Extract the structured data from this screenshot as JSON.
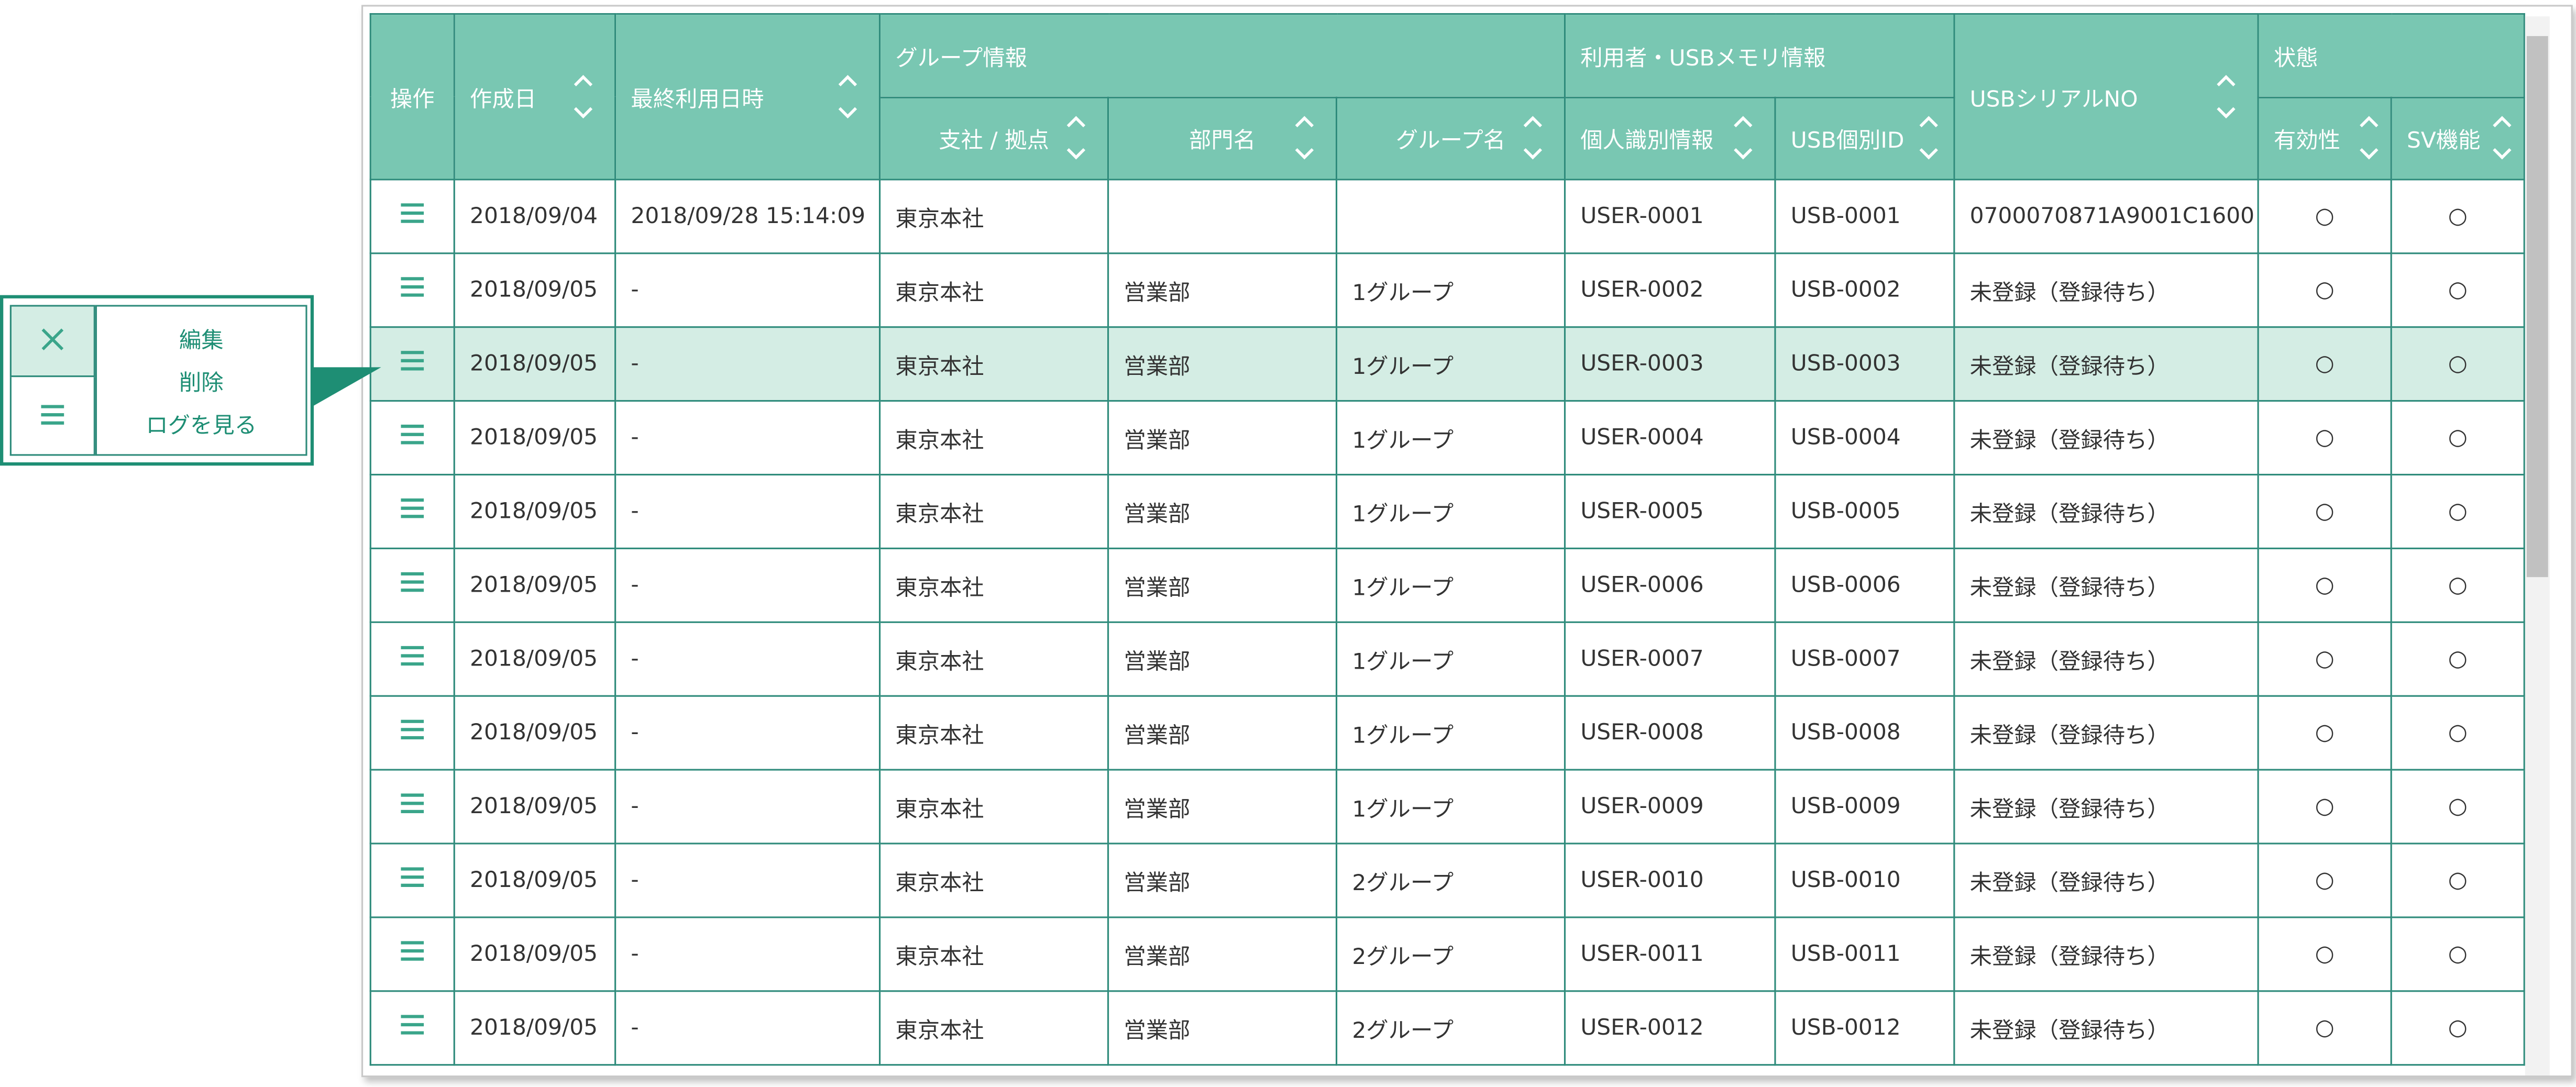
{
  "header": {
    "ops": "操作",
    "created": "作成日",
    "last_used": "最終利用日時",
    "group_info": "グループ情報",
    "branch": "支社 / 拠点",
    "department": "部門名",
    "group_name": "グループ名",
    "user_usb_info": "利用者・USBメモリ情報",
    "personal_id": "個人識別情報",
    "usb_id": "USB個別ID",
    "usb_serial": "USBシリアルNO",
    "status": "状態",
    "validity": "有効性",
    "sv": "SV機能"
  },
  "rows": [
    {
      "created": "2018/09/04",
      "last_used": "2018/09/28 15:14:09",
      "branch": "東京本社",
      "department": "",
      "group": "",
      "user": "USER-0001",
      "usb": "USB-0001",
      "serial": "0700070871A9001C1600",
      "valid": "○",
      "sv": "○"
    },
    {
      "created": "2018/09/05",
      "last_used": "-",
      "branch": "東京本社",
      "department": "営業部",
      "group": "1グループ",
      "user": "USER-0002",
      "usb": "USB-0002",
      "serial": "未登録（登録待ち）",
      "valid": "○",
      "sv": "○"
    },
    {
      "created": "2018/09/05",
      "last_used": "-",
      "branch": "東京本社",
      "department": "営業部",
      "group": "1グループ",
      "user": "USER-0003",
      "usb": "USB-0003",
      "serial": "未登録（登録待ち）",
      "valid": "○",
      "sv": "○"
    },
    {
      "created": "2018/09/05",
      "last_used": "-",
      "branch": "東京本社",
      "department": "営業部",
      "group": "1グループ",
      "user": "USER-0004",
      "usb": "USB-0004",
      "serial": "未登録（登録待ち）",
      "valid": "○",
      "sv": "○"
    },
    {
      "created": "2018/09/05",
      "last_used": "-",
      "branch": "東京本社",
      "department": "営業部",
      "group": "1グループ",
      "user": "USER-0005",
      "usb": "USB-0005",
      "serial": "未登録（登録待ち）",
      "valid": "○",
      "sv": "○"
    },
    {
      "created": "2018/09/05",
      "last_used": "-",
      "branch": "東京本社",
      "department": "営業部",
      "group": "1グループ",
      "user": "USER-0006",
      "usb": "USB-0006",
      "serial": "未登録（登録待ち）",
      "valid": "○",
      "sv": "○"
    },
    {
      "created": "2018/09/05",
      "last_used": "-",
      "branch": "東京本社",
      "department": "営業部",
      "group": "1グループ",
      "user": "USER-0007",
      "usb": "USB-0007",
      "serial": "未登録（登録待ち）",
      "valid": "○",
      "sv": "○"
    },
    {
      "created": "2018/09/05",
      "last_used": "-",
      "branch": "東京本社",
      "department": "営業部",
      "group": "1グループ",
      "user": "USER-0008",
      "usb": "USB-0008",
      "serial": "未登録（登録待ち）",
      "valid": "○",
      "sv": "○"
    },
    {
      "created": "2018/09/05",
      "last_used": "-",
      "branch": "東京本社",
      "department": "営業部",
      "group": "1グループ",
      "user": "USER-0009",
      "usb": "USB-0009",
      "serial": "未登録（登録待ち）",
      "valid": "○",
      "sv": "○"
    },
    {
      "created": "2018/09/05",
      "last_used": "-",
      "branch": "東京本社",
      "department": "営業部",
      "group": "2グループ",
      "user": "USER-0010",
      "usb": "USB-0010",
      "serial": "未登録（登録待ち）",
      "valid": "○",
      "sv": "○"
    },
    {
      "created": "2018/09/05",
      "last_used": "-",
      "branch": "東京本社",
      "department": "営業部",
      "group": "2グループ",
      "user": "USER-0011",
      "usb": "USB-0011",
      "serial": "未登録（登録待ち）",
      "valid": "○",
      "sv": "○"
    },
    {
      "created": "2018/09/05",
      "last_used": "-",
      "branch": "東京本社",
      "department": "営業部",
      "group": "2グループ",
      "user": "USER-0012",
      "usb": "USB-0012",
      "serial": "未登録（登録待ち）",
      "valid": "○",
      "sv": "○"
    }
  ],
  "highlight_row": 2,
  "context_menu": {
    "edit": "編集",
    "delete": "削除",
    "view_log": "ログを見る"
  },
  "icons": {
    "row_menu": "hamburger-menu-icon",
    "close": "close-icon",
    "sort": "sort-up-down-icon",
    "callout_pointer": "callout-arrow-icon"
  },
  "colors": {
    "header_bg": "#79c7b2",
    "grid_line": "#2e8b7b",
    "accent": "#1e8e74",
    "selected_row_bg": "#d4ede4"
  }
}
